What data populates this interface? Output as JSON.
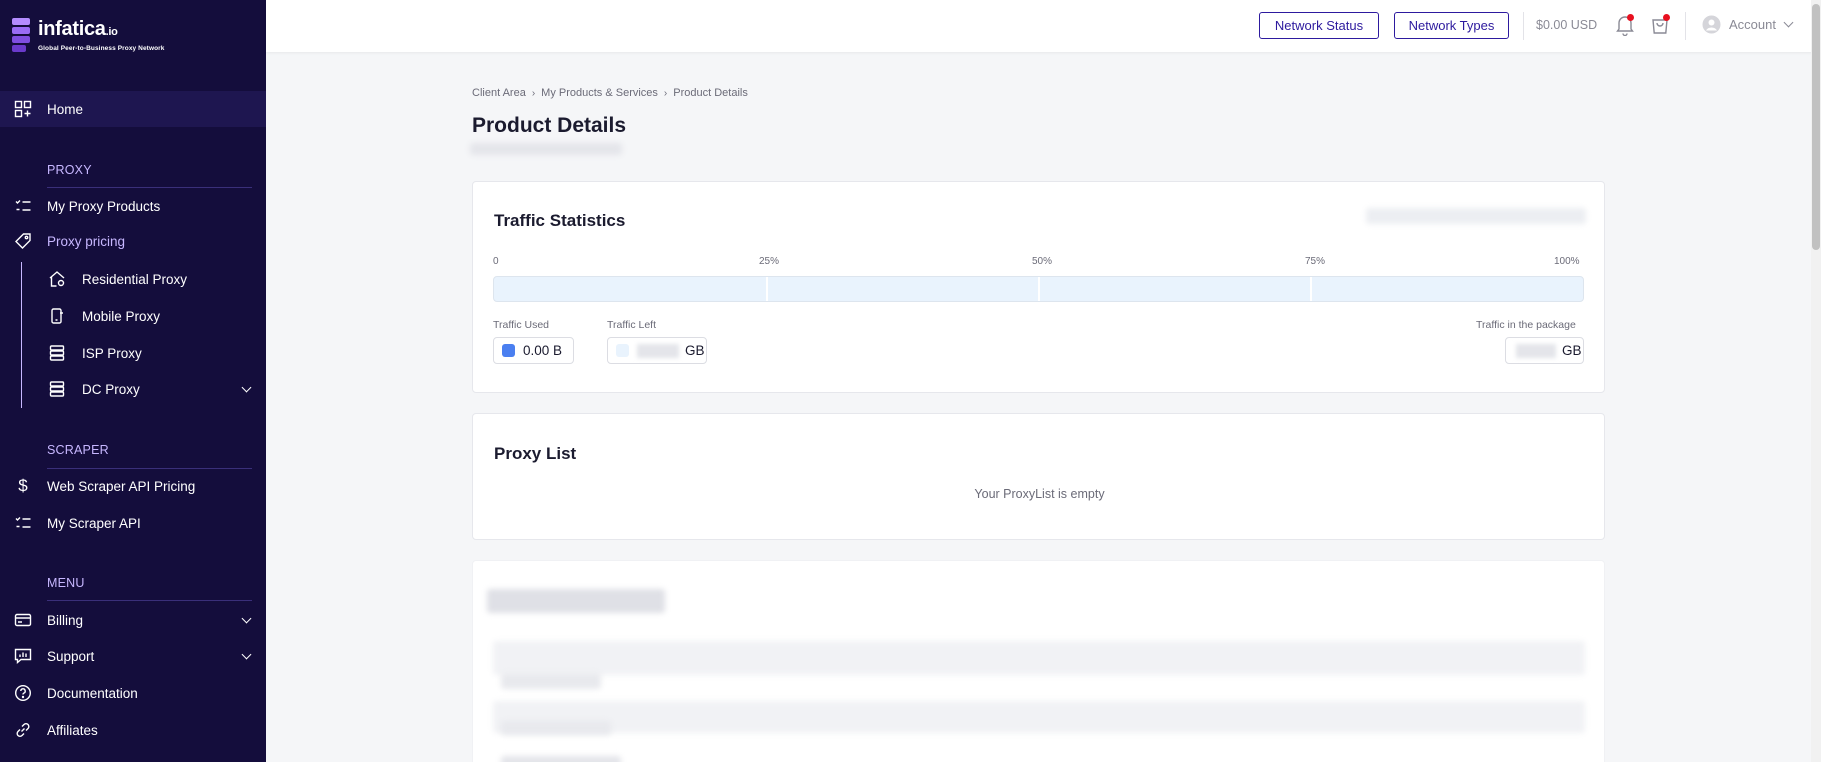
{
  "brand": {
    "name": "infatica",
    "suffix": ".io",
    "tagline": "Global Peer-to-Business Proxy Network",
    "colors": {
      "sidebar": "#140d3c",
      "accent": "#c7b7ff",
      "primary": "#2d1a9e"
    }
  },
  "sidebar": {
    "home": {
      "label": "Home",
      "icon": "dashboard-icon"
    },
    "proxy_section": "PROXY",
    "proxy_items": [
      {
        "label": "My Proxy Products",
        "icon": "list-icon"
      },
      {
        "label": "Proxy pricing",
        "icon": "tag-icon"
      }
    ],
    "pricing_sub": [
      {
        "label": "Residential Proxy",
        "icon": "house-icon"
      },
      {
        "label": "Mobile Proxy",
        "icon": "mobile-icon"
      },
      {
        "label": "ISP Proxy",
        "icon": "server-icon"
      },
      {
        "label": "DC Proxy",
        "icon": "server-icon"
      }
    ],
    "scraper_section": "SCRAPER",
    "scraper_items": [
      {
        "label": "Web Scraper API Pricing",
        "icon": "dollar-icon"
      },
      {
        "label": "My Scraper API",
        "icon": "list-icon"
      }
    ],
    "menu_section": "MENU",
    "menu_items": [
      {
        "label": "Billing",
        "icon": "card-icon"
      },
      {
        "label": "Support",
        "icon": "support-icon"
      },
      {
        "label": "Documentation",
        "icon": "help-icon"
      },
      {
        "label": "Affiliates",
        "icon": "link-icon"
      }
    ]
  },
  "header": {
    "network_status": "Network Status",
    "network_types": "Network Types",
    "balance": "$0.00 USD",
    "account": "Account"
  },
  "breadcrumb": [
    "Client Area",
    "My Products & Services",
    "Product Details"
  ],
  "page_title": "Product Details",
  "traffic": {
    "title": "Traffic Statistics",
    "scale": [
      "0",
      "25%",
      "50%",
      "75%",
      "100%"
    ],
    "used_fraction": 0,
    "used_label": "Traffic Used",
    "used_value": "0.00 B",
    "used_color": "#4a7ff0",
    "left_label": "Traffic Left",
    "left_unit": "GB",
    "left_color": "#e9f3fd",
    "package_label": "Traffic in the package",
    "package_unit": "GB"
  },
  "proxy_list": {
    "title": "Proxy List",
    "empty": "Your ProxyList is empty"
  }
}
